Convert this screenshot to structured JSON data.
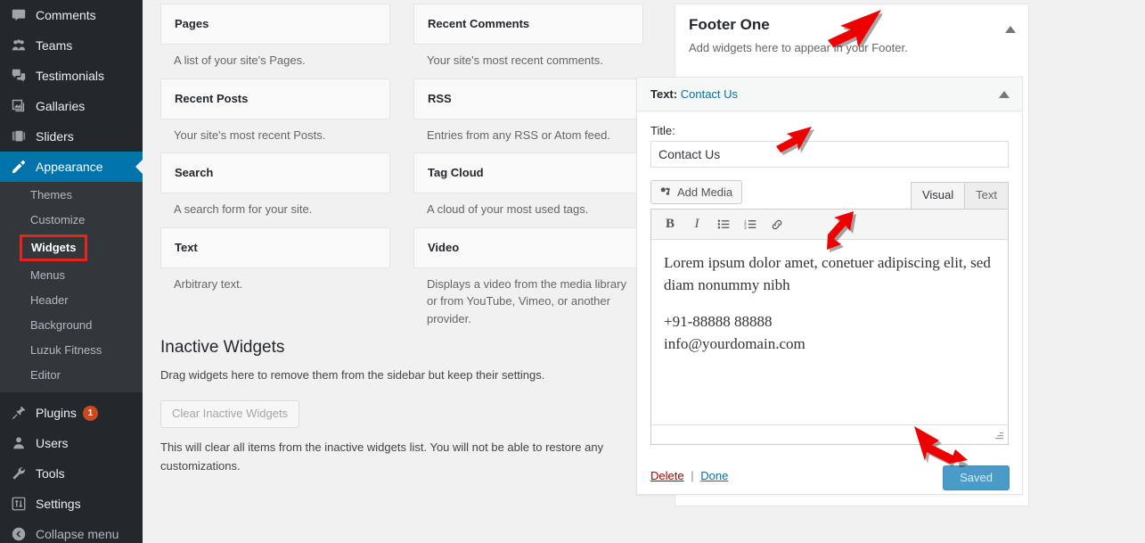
{
  "sidebar": {
    "items": [
      {
        "label": "Comments",
        "icon": "comments-icon",
        "current": false
      },
      {
        "label": "Teams",
        "icon": "teams-icon",
        "current": false
      },
      {
        "label": "Testimonials",
        "icon": "testimonials-icon",
        "current": false
      },
      {
        "label": "Gallaries",
        "icon": "gallaries-icon",
        "current": false
      },
      {
        "label": "Sliders",
        "icon": "sliders-icon",
        "current": false
      },
      {
        "label": "Appearance",
        "icon": "appearance-icon",
        "current": true
      }
    ],
    "submenu": [
      {
        "label": "Themes",
        "current": false
      },
      {
        "label": "Customize",
        "current": false
      },
      {
        "label": "Widgets",
        "current": true
      },
      {
        "label": "Menus",
        "current": false
      },
      {
        "label": "Header",
        "current": false
      },
      {
        "label": "Background",
        "current": false
      },
      {
        "label": "Luzuk Fitness",
        "current": false
      },
      {
        "label": "Editor",
        "current": false
      }
    ],
    "items_bottom": [
      {
        "label": "Plugins",
        "icon": "plugins-icon",
        "badge": "1"
      },
      {
        "label": "Users",
        "icon": "users-icon",
        "badge": ""
      },
      {
        "label": "Tools",
        "icon": "tools-icon",
        "badge": ""
      },
      {
        "label": "Settings",
        "icon": "settings-icon",
        "badge": ""
      }
    ],
    "collapse_label": "Collapse menu",
    "highlight_color": "#0073aa",
    "badge_color": "#ca4a1f",
    "widgets_outline_color": "#e8231f"
  },
  "available_widgets": {
    "left_column": [
      {
        "title": "Pages",
        "description": "A list of your site's Pages."
      },
      {
        "title": "Recent Posts",
        "description": "Your site's most recent Posts."
      },
      {
        "title": "Search",
        "description": "A search form for your site."
      },
      {
        "title": "Text",
        "description": "Arbitrary text."
      }
    ],
    "right_column": [
      {
        "title": "Recent Comments",
        "description": "Your site's most recent comments."
      },
      {
        "title": "RSS",
        "description": "Entries from any RSS or Atom feed."
      },
      {
        "title": "Tag Cloud",
        "description": "A cloud of your most used tags."
      },
      {
        "title": "Video",
        "description": "Displays a video from the media library or from YouTube, Vimeo, or another provider."
      }
    ]
  },
  "inactive_widgets": {
    "heading": "Inactive Widgets",
    "description": "Drag widgets here to remove them from the sidebar but keep their settings.",
    "clear_button": "Clear Inactive Widgets",
    "note": "This will clear all items from the inactive widgets list. You will not be able to restore any customizations."
  },
  "footer_panel": {
    "title": "Footer One",
    "subtitle": "Add widgets here to appear in your Footer.",
    "toggle_icon": "chevron-up-icon"
  },
  "text_widget": {
    "header_kind": "Text:",
    "header_name": "Contact Us",
    "toggle_icon": "chevron-up-icon",
    "title_label": "Title:",
    "title_value": "Contact Us",
    "title_placeholder": "",
    "add_media_label": "Add Media",
    "add_media_icon": "media-icon",
    "editor_tabs": [
      {
        "label": "Visual",
        "active": true
      },
      {
        "label": "Text",
        "active": false
      }
    ],
    "toolbar_buttons": [
      {
        "icon": "bold-icon",
        "label": "B"
      },
      {
        "icon": "italic-icon",
        "label": "I"
      },
      {
        "icon": "bullet-list-icon",
        "label": ""
      },
      {
        "icon": "numbered-list-icon",
        "label": ""
      },
      {
        "icon": "link-icon",
        "label": ""
      }
    ],
    "content_paragraphs": [
      "Lorem ipsum dolor amet, conetuer adipiscing elit, sed diam nonummy nibh",
      "+91-88888 88888\ninfo@yourdomain.com"
    ],
    "delete_label": "Delete",
    "separator": "|",
    "done_label": "Done",
    "save_label": "Saved",
    "save_button_color": "#4a9bc8",
    "resize_handle_icon": "resize-grip-icon"
  },
  "annotations": {
    "arrows": [
      {
        "name": "arrow-footer-one",
        "target": "Footer One heading"
      },
      {
        "name": "arrow-title-field",
        "target": "Title input"
      },
      {
        "name": "arrow-editor-content",
        "target": "Editor content area"
      },
      {
        "name": "arrow-saved-button",
        "target": "Saved button"
      }
    ],
    "arrow_color": "#ee0000"
  }
}
